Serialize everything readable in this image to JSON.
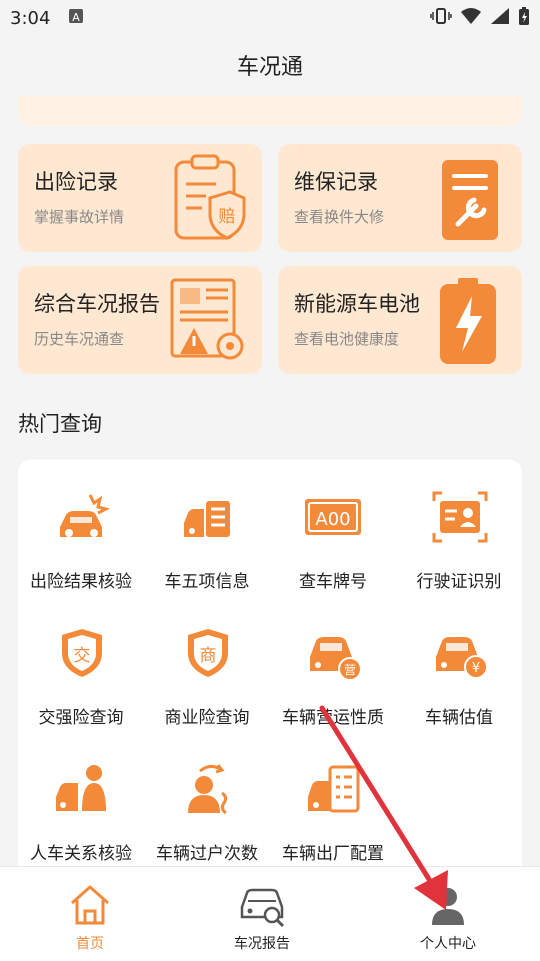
{
  "status": {
    "time": "3:04"
  },
  "header": {
    "title": "车况通"
  },
  "cards": [
    {
      "title": "出险记录",
      "subtitle": "掌握事故详情",
      "icon": "insurance-claim-doc-icon"
    },
    {
      "title": "维保记录",
      "subtitle": "查看换件大修",
      "icon": "maintenance-doc-icon"
    },
    {
      "title": "综合车况报告",
      "subtitle": "历史车况通查",
      "icon": "report-warning-icon"
    },
    {
      "title": "新能源车电池",
      "subtitle": "查看电池健康度",
      "icon": "battery-charge-icon"
    }
  ],
  "hot_section": {
    "title": "热门查询",
    "items": [
      {
        "label": "出险结果核验",
        "icon": "car-crash-icon"
      },
      {
        "label": "车五项信息",
        "icon": "car-info-icon"
      },
      {
        "label": "查车牌号",
        "icon": "license-plate-icon",
        "plate_text": "A00"
      },
      {
        "label": "行驶证识别",
        "icon": "id-card-scan-icon"
      },
      {
        "label": "交强险查询",
        "icon": "shield-jiao-icon",
        "badge": "交"
      },
      {
        "label": "商业险查询",
        "icon": "shield-shang-icon",
        "badge": "商"
      },
      {
        "label": "车辆营运性质",
        "icon": "car-operation-icon",
        "badge": "营"
      },
      {
        "label": "车辆估值",
        "icon": "car-value-icon",
        "badge": "¥"
      },
      {
        "label": "人车关系核验",
        "icon": "person-car-icon"
      },
      {
        "label": "车辆过户次数",
        "icon": "person-transfer-icon"
      },
      {
        "label": "车辆出厂配置",
        "icon": "car-config-icon"
      }
    ]
  },
  "bottom_nav": [
    {
      "label": "首页",
      "icon": "home-icon",
      "active": true
    },
    {
      "label": "车况报告",
      "icon": "car-report-icon",
      "active": false
    },
    {
      "label": "个人中心",
      "icon": "person-icon",
      "active": false
    }
  ],
  "colors": {
    "accent": "#f28a3a",
    "card_bg": "#ffe8d1",
    "arrow": "#e0333c"
  }
}
